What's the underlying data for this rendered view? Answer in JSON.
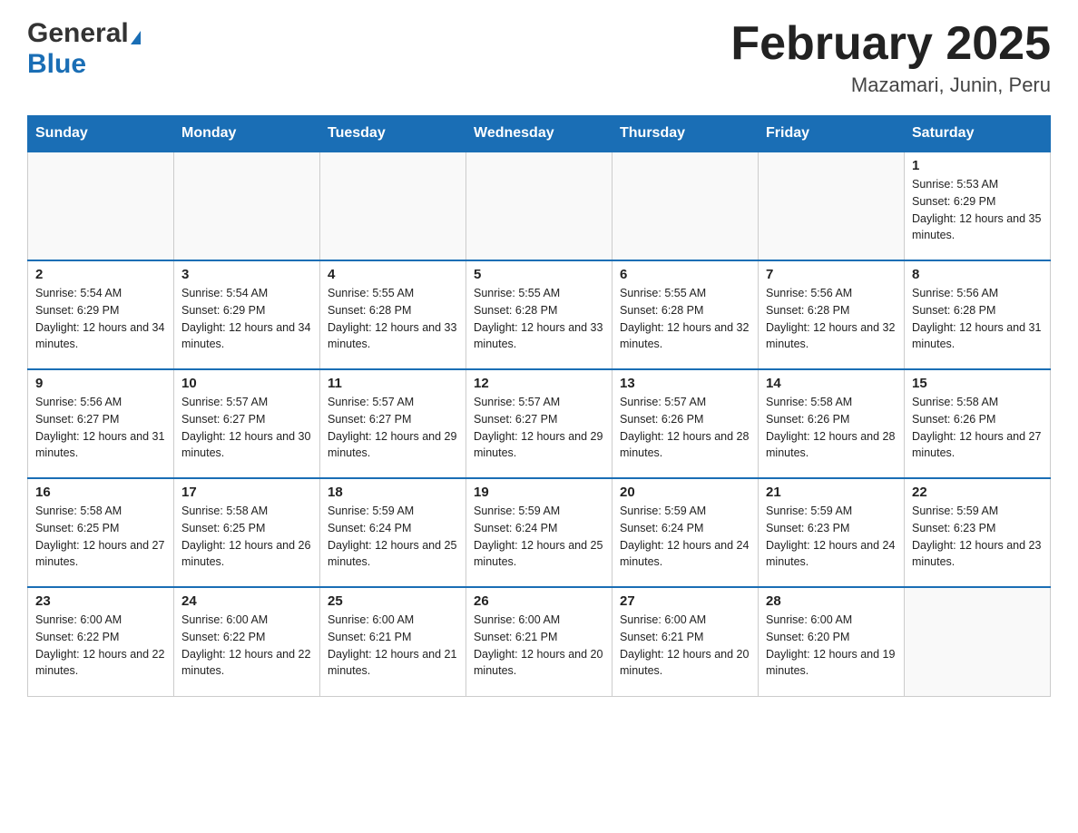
{
  "header": {
    "logo_general": "General",
    "logo_blue": "Blue",
    "month_title": "February 2025",
    "location": "Mazamari, Junin, Peru"
  },
  "weekdays": [
    "Sunday",
    "Monday",
    "Tuesday",
    "Wednesday",
    "Thursday",
    "Friday",
    "Saturday"
  ],
  "weeks": [
    [
      {
        "day": "",
        "info": ""
      },
      {
        "day": "",
        "info": ""
      },
      {
        "day": "",
        "info": ""
      },
      {
        "day": "",
        "info": ""
      },
      {
        "day": "",
        "info": ""
      },
      {
        "day": "",
        "info": ""
      },
      {
        "day": "1",
        "info": "Sunrise: 5:53 AM\nSunset: 6:29 PM\nDaylight: 12 hours and 35 minutes."
      }
    ],
    [
      {
        "day": "2",
        "info": "Sunrise: 5:54 AM\nSunset: 6:29 PM\nDaylight: 12 hours and 34 minutes."
      },
      {
        "day": "3",
        "info": "Sunrise: 5:54 AM\nSunset: 6:29 PM\nDaylight: 12 hours and 34 minutes."
      },
      {
        "day": "4",
        "info": "Sunrise: 5:55 AM\nSunset: 6:28 PM\nDaylight: 12 hours and 33 minutes."
      },
      {
        "day": "5",
        "info": "Sunrise: 5:55 AM\nSunset: 6:28 PM\nDaylight: 12 hours and 33 minutes."
      },
      {
        "day": "6",
        "info": "Sunrise: 5:55 AM\nSunset: 6:28 PM\nDaylight: 12 hours and 32 minutes."
      },
      {
        "day": "7",
        "info": "Sunrise: 5:56 AM\nSunset: 6:28 PM\nDaylight: 12 hours and 32 minutes."
      },
      {
        "day": "8",
        "info": "Sunrise: 5:56 AM\nSunset: 6:28 PM\nDaylight: 12 hours and 31 minutes."
      }
    ],
    [
      {
        "day": "9",
        "info": "Sunrise: 5:56 AM\nSunset: 6:27 PM\nDaylight: 12 hours and 31 minutes."
      },
      {
        "day": "10",
        "info": "Sunrise: 5:57 AM\nSunset: 6:27 PM\nDaylight: 12 hours and 30 minutes."
      },
      {
        "day": "11",
        "info": "Sunrise: 5:57 AM\nSunset: 6:27 PM\nDaylight: 12 hours and 29 minutes."
      },
      {
        "day": "12",
        "info": "Sunrise: 5:57 AM\nSunset: 6:27 PM\nDaylight: 12 hours and 29 minutes."
      },
      {
        "day": "13",
        "info": "Sunrise: 5:57 AM\nSunset: 6:26 PM\nDaylight: 12 hours and 28 minutes."
      },
      {
        "day": "14",
        "info": "Sunrise: 5:58 AM\nSunset: 6:26 PM\nDaylight: 12 hours and 28 minutes."
      },
      {
        "day": "15",
        "info": "Sunrise: 5:58 AM\nSunset: 6:26 PM\nDaylight: 12 hours and 27 minutes."
      }
    ],
    [
      {
        "day": "16",
        "info": "Sunrise: 5:58 AM\nSunset: 6:25 PM\nDaylight: 12 hours and 27 minutes."
      },
      {
        "day": "17",
        "info": "Sunrise: 5:58 AM\nSunset: 6:25 PM\nDaylight: 12 hours and 26 minutes."
      },
      {
        "day": "18",
        "info": "Sunrise: 5:59 AM\nSunset: 6:24 PM\nDaylight: 12 hours and 25 minutes."
      },
      {
        "day": "19",
        "info": "Sunrise: 5:59 AM\nSunset: 6:24 PM\nDaylight: 12 hours and 25 minutes."
      },
      {
        "day": "20",
        "info": "Sunrise: 5:59 AM\nSunset: 6:24 PM\nDaylight: 12 hours and 24 minutes."
      },
      {
        "day": "21",
        "info": "Sunrise: 5:59 AM\nSunset: 6:23 PM\nDaylight: 12 hours and 24 minutes."
      },
      {
        "day": "22",
        "info": "Sunrise: 5:59 AM\nSunset: 6:23 PM\nDaylight: 12 hours and 23 minutes."
      }
    ],
    [
      {
        "day": "23",
        "info": "Sunrise: 6:00 AM\nSunset: 6:22 PM\nDaylight: 12 hours and 22 minutes."
      },
      {
        "day": "24",
        "info": "Sunrise: 6:00 AM\nSunset: 6:22 PM\nDaylight: 12 hours and 22 minutes."
      },
      {
        "day": "25",
        "info": "Sunrise: 6:00 AM\nSunset: 6:21 PM\nDaylight: 12 hours and 21 minutes."
      },
      {
        "day": "26",
        "info": "Sunrise: 6:00 AM\nSunset: 6:21 PM\nDaylight: 12 hours and 20 minutes."
      },
      {
        "day": "27",
        "info": "Sunrise: 6:00 AM\nSunset: 6:21 PM\nDaylight: 12 hours and 20 minutes."
      },
      {
        "day": "28",
        "info": "Sunrise: 6:00 AM\nSunset: 6:20 PM\nDaylight: 12 hours and 19 minutes."
      },
      {
        "day": "",
        "info": ""
      }
    ]
  ]
}
